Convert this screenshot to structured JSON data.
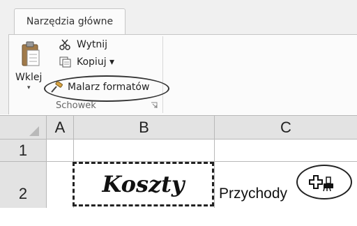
{
  "ribbon": {
    "tab_label": "Narzędzia główne",
    "paste_label": "Wklej",
    "paste_arrow": "▾",
    "commands": {
      "cut": "Wytnij",
      "copy": "Kopiuj ▾",
      "format_painter": "Malarz formatów"
    },
    "group_label": "Schowek"
  },
  "sheet": {
    "columns": [
      "A",
      "B",
      "C"
    ],
    "rows": [
      "1",
      "2"
    ],
    "cells": {
      "B2": "Koszty",
      "C2": "Przychody"
    }
  },
  "icons": [
    "paste-icon",
    "scissors-icon",
    "copy-icon",
    "brush-icon",
    "dialog-launcher-icon",
    "format-painter-cursor-icon",
    "select-all-icon"
  ]
}
